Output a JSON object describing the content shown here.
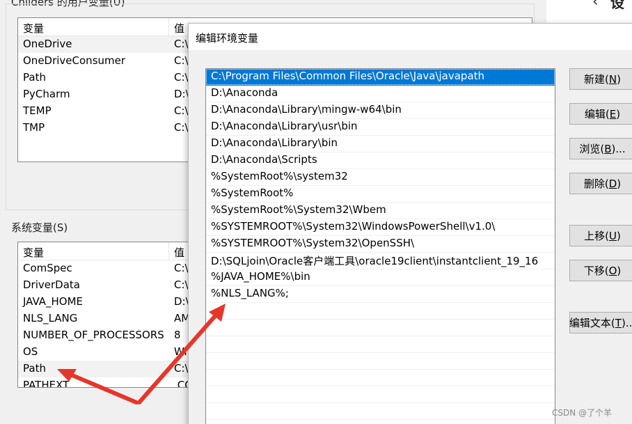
{
  "background_window": {
    "partial_title": "设",
    "user_vars": {
      "group_label": "Childers 的用户变量(U)",
      "col_var": "变量",
      "col_val": "值",
      "rows": [
        {
          "name": "OneDrive",
          "value": "C:\\"
        },
        {
          "name": "OneDriveConsumer",
          "value": "C:\\"
        },
        {
          "name": "Path",
          "value": "C:\\"
        },
        {
          "name": "PyCharm",
          "value": "D:\\"
        },
        {
          "name": "TEMP",
          "value": "C:\\"
        },
        {
          "name": "TMP",
          "value": "C:\\"
        }
      ]
    },
    "system_vars": {
      "group_label": "系统变量(S)",
      "col_var": "变量",
      "col_val": "值",
      "rows": [
        {
          "name": "ComSpec",
          "value": "C:\\"
        },
        {
          "name": "DriverData",
          "value": "C:\\"
        },
        {
          "name": "JAVA_HOME",
          "value": "D:\\"
        },
        {
          "name": "NLS_LANG",
          "value": "AM"
        },
        {
          "name": "NUMBER_OF_PROCESSORS",
          "value": "8"
        },
        {
          "name": "OS",
          "value": "Wi"
        },
        {
          "name": "Path",
          "value": "C:\\"
        },
        {
          "name": "PATHEXT",
          "value": ".CO"
        }
      ]
    }
  },
  "dialog": {
    "title": "编辑环境变量",
    "paths": [
      "C:\\Program Files\\Common Files\\Oracle\\Java\\javapath",
      "D:\\Anaconda",
      "D:\\Anaconda\\Library\\mingw-w64\\bin",
      "D:\\Anaconda\\Library\\usr\\bin",
      "D:\\Anaconda\\Library\\bin",
      "D:\\Anaconda\\Scripts",
      "%SystemRoot%\\system32",
      "%SystemRoot%",
      "%SystemRoot%\\System32\\Wbem",
      "%SYSTEMROOT%\\System32\\WindowsPowerShell\\v1.0\\",
      "%SYSTEMROOT%\\System32\\OpenSSH\\",
      "D:\\SQLjoin\\Oracle客户端工具\\oracle19client\\instantclient_19_16",
      "%JAVA_HOME%\\bin",
      "%NLS_LANG%;",
      "",
      "",
      "",
      "",
      "",
      "",
      "",
      ""
    ],
    "buttons": {
      "new": {
        "label": "新建(",
        "key": "N",
        "suffix": ")"
      },
      "edit": {
        "label": "编辑(",
        "key": "E",
        "suffix": ")"
      },
      "browse": {
        "label": "浏览(",
        "key": "B",
        "suffix": ")..."
      },
      "delete": {
        "label": "删除(",
        "key": "D",
        "suffix": ")"
      },
      "move_up": {
        "label": "上移(",
        "key": "U",
        "suffix": ")"
      },
      "move_down": {
        "label": "下移(",
        "key": "O",
        "suffix": ")"
      },
      "edit_text": {
        "label": "编辑文本(",
        "key": "T",
        "suffix": ")..."
      }
    }
  },
  "annotation": {
    "arrow_color": "#e8352a"
  },
  "watermark": "CSDN @了个羊"
}
